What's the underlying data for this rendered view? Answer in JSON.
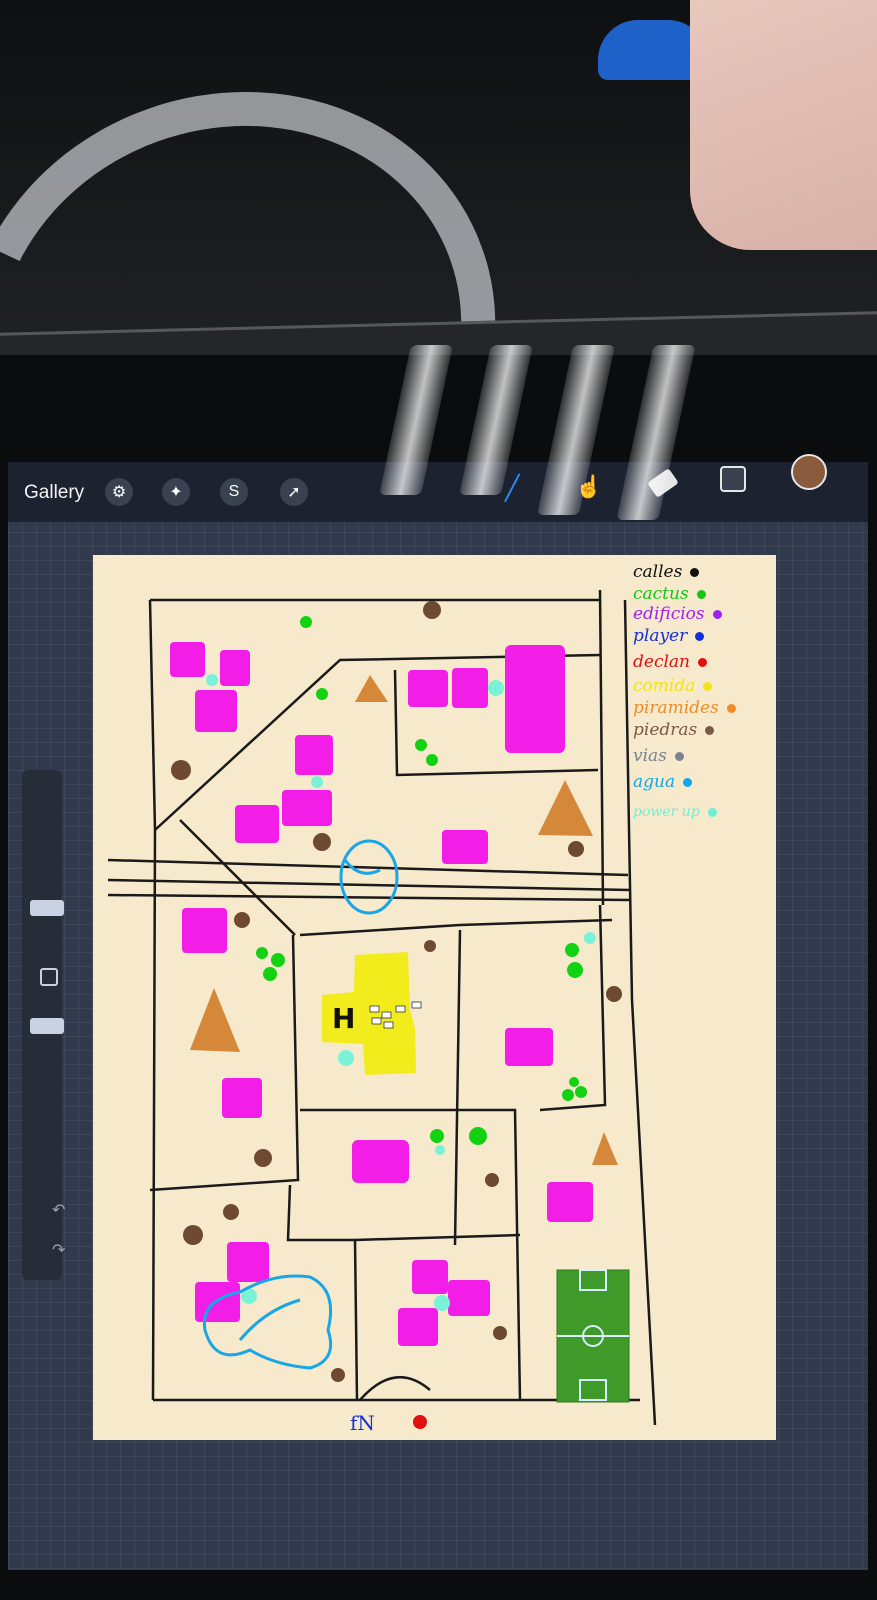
{
  "app": {
    "gallery_label": "Gallery"
  },
  "toolbar": {
    "left_icons": [
      "wrench-icon",
      "magic-wand-icon",
      "selection-icon",
      "transform-arrow-icon"
    ],
    "right_icons": [
      "brush-icon",
      "smudge-icon",
      "eraser-icon",
      "layers-icon"
    ],
    "active_color": "#8a5a3c"
  },
  "legend": [
    {
      "label": "calles",
      "color": "#111111"
    },
    {
      "label": "cactus",
      "color": "#16c416"
    },
    {
      "label": "edificios",
      "color": "#a020f0"
    },
    {
      "label": "player",
      "color": "#1430d8"
    },
    {
      "label": "declan",
      "color": "#e01010"
    },
    {
      "label": "comida",
      "color": "#f2e21a"
    },
    {
      "label": "piramides",
      "color": "#f08c28"
    },
    {
      "label": "piedras",
      "color": "#7a5a40"
    },
    {
      "label": "vias",
      "color": "#7c8290"
    },
    {
      "label": "agua",
      "color": "#10a8e8"
    },
    {
      "label": "power up",
      "color": "#6ef0d0"
    }
  ],
  "map": {
    "hospital_label": "H"
  }
}
